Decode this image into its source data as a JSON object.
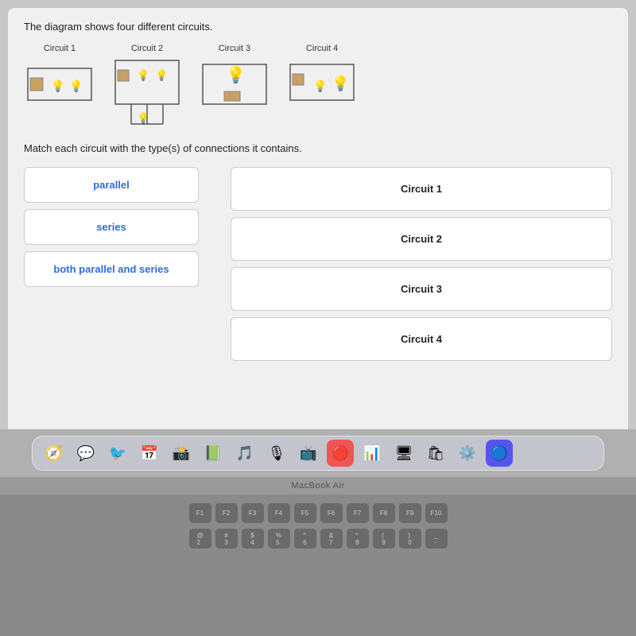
{
  "page": {
    "description": "The diagram shows four different circuits.",
    "match_instruction": "Match each circuit with the type(s) of connections it contains.",
    "circuits": [
      {
        "id": "circuit1",
        "label": "Circuit 1"
      },
      {
        "id": "circuit2",
        "label": "Circuit 2"
      },
      {
        "id": "circuit3",
        "label": "Circuit 3"
      },
      {
        "id": "circuit4",
        "label": "Circuit 4"
      }
    ],
    "choices": [
      {
        "id": "parallel",
        "label": "parallel"
      },
      {
        "id": "series",
        "label": "series"
      },
      {
        "id": "both",
        "label": "both parallel and series"
      }
    ],
    "slots": [
      {
        "id": "slot1",
        "label": "Circuit 1"
      },
      {
        "id": "slot2",
        "label": "Circuit 2"
      },
      {
        "id": "slot3",
        "label": "Circuit 3"
      },
      {
        "id": "slot4",
        "label": "Circuit 4"
      }
    ],
    "macbook_label": "MacBook Air",
    "dock_icons": [
      "🧭",
      "💬",
      "🐦",
      "📅",
      "📸",
      "📗",
      "🎵",
      "🎙",
      "📺",
      "🔴",
      "📊",
      "🖥",
      "🛍",
      "⚙️",
      "🔵"
    ],
    "keyboard_rows": [
      [
        "F1",
        "F2",
        "F3",
        "F4",
        "F5",
        "F6",
        "F7",
        "F8",
        "F9",
        "F10"
      ],
      [
        "@2",
        "#3",
        "$4",
        "%5",
        "^6",
        "&7",
        "*8",
        "(9",
        ")0",
        "-"
      ]
    ]
  }
}
